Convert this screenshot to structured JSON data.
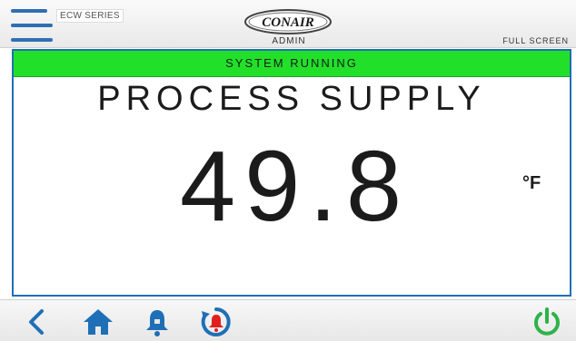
{
  "header": {
    "series_label": "ECW SERIES",
    "brand": "CONAIR",
    "role": "ADMIN",
    "fullscreen_label": "FULL SCREEN"
  },
  "status": {
    "text": "SYSTEM RUNNING",
    "color": "#22e02a"
  },
  "display": {
    "title": "PROCESS SUPPLY",
    "value": "49.8",
    "unit": "°F"
  },
  "footer": {
    "icons": [
      "back-icon",
      "home-icon",
      "bell-icon",
      "alarm-reset-icon",
      "power-icon"
    ],
    "accent_color": "#1f6fb6",
    "alarm_color": "#e02020",
    "power_color": "#2db34a"
  },
  "colors": {
    "border": "#1f6fb6",
    "text": "#1b1b1b"
  }
}
